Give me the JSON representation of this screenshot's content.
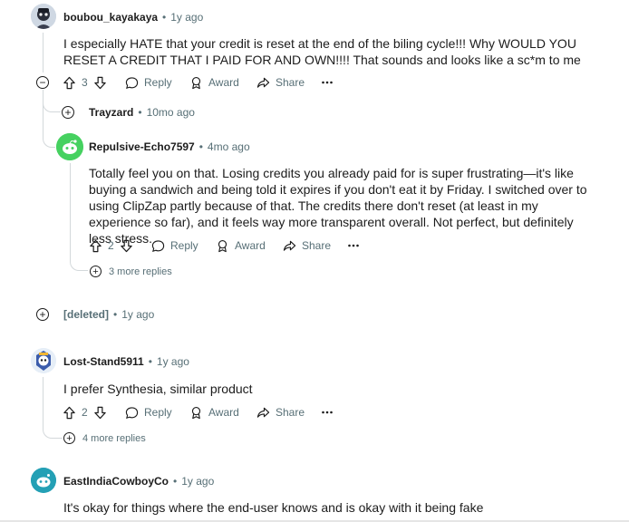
{
  "comments": [
    {
      "author": "boubou_kayakaya",
      "time": "1y ago",
      "body": "I especially HATE that your credit is reset at the end of the biling cycle!!! Why WOULD YOU RESET A CREDIT THAT I PAID FOR AND OWN!!!! That sounds and looks like a sc*m to me",
      "votes": "3"
    },
    {
      "author": "Trayzard",
      "time": "10mo ago"
    },
    {
      "author": "Repulsive-Echo7597",
      "time": "4mo ago",
      "body": "Totally feel you on that. Losing credits you already paid for is super frustrating—it's like buying a sandwich and being told it expires if you don't eat it by Friday. I switched over to using ClipZap partly because of that. The credits there don't reset (at least in my experience so far), and it feels way more transparent overall. Not perfect, but definitely less stress.",
      "votes": "2",
      "more_replies": "3 more replies"
    },
    {
      "author": "[deleted]",
      "time": "1y ago"
    },
    {
      "author": "Lost-Stand5911",
      "time": "1y ago",
      "body": "I prefer Synthesia, similar product",
      "votes": "2",
      "more_replies": "4 more replies"
    },
    {
      "author": "EastIndiaCowboyCo",
      "time": "1y ago",
      "body": "It's okay for things where the end-user knows and is okay with it being fake"
    }
  ],
  "actions": {
    "reply": "Reply",
    "award": "Award",
    "share": "Share"
  },
  "separator": "•",
  "colors": {
    "meta": "#576f76",
    "thread_line": "#d3d8db",
    "green_avatar": "#46d160",
    "teal_avatar": "#24a0b5"
  }
}
